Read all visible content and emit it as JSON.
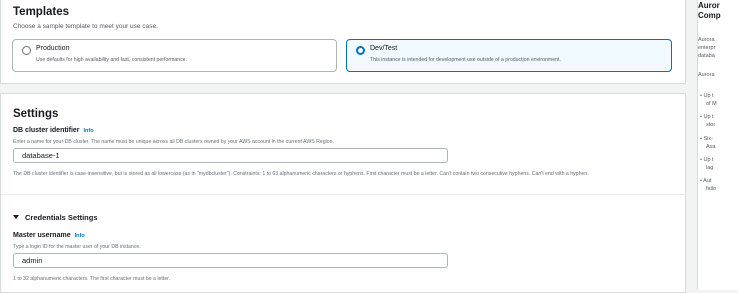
{
  "templates": {
    "title": "Templates",
    "subtitle": "Choose a sample template to meet your use case.",
    "options": [
      {
        "title": "Production",
        "desc": "Use defaults for high availability and fast, consistent performance.",
        "selected": false
      },
      {
        "title": "Dev/Test",
        "desc": "This instance is intended for development use outside of a production environment.",
        "selected": true
      }
    ]
  },
  "settings": {
    "title": "Settings",
    "cluster_identifier": {
      "label": "DB cluster identifier",
      "info": "Info",
      "desc": "Enter a name for your DB cluster. The name must be unique across all DB clusters owned by your AWS account in the current AWS Region.",
      "value": "database-1",
      "constraint": "The DB cluster identifier is case-insensitive, but is stored as all lowercase (as in \"mydbcluster\"). Constraints: 1 to 63 alphanumeric characters or hyphens. First character must be a letter. Can't contain two consecutive hyphens. Can't end with a hyphen."
    },
    "credentials_section": "Credentials Settings",
    "master_username": {
      "label": "Master username",
      "info": "Info",
      "desc": "Type a login ID for the master user of your DB instance.",
      "value": "admin",
      "constraint": "1 to 32 alphanumeric characters. The first character must be a letter."
    }
  },
  "side_panel": {
    "title_lines": [
      "Auror",
      "Comp"
    ],
    "para1_lines": [
      "Aurora",
      "enterpr",
      "databa"
    ],
    "para2": "Aurora",
    "bullets": [
      [
        "Up t",
        "of M"
      ],
      [
        "Up t",
        "stor"
      ],
      [
        "Six-",
        "Ava"
      ],
      [
        "Up t",
        "lag"
      ],
      [
        "Aut",
        "failo"
      ]
    ]
  },
  "colors": {
    "accent": "#0073bb",
    "panel_bg": "#ffffff",
    "page_bg": "#f2f3f3"
  }
}
